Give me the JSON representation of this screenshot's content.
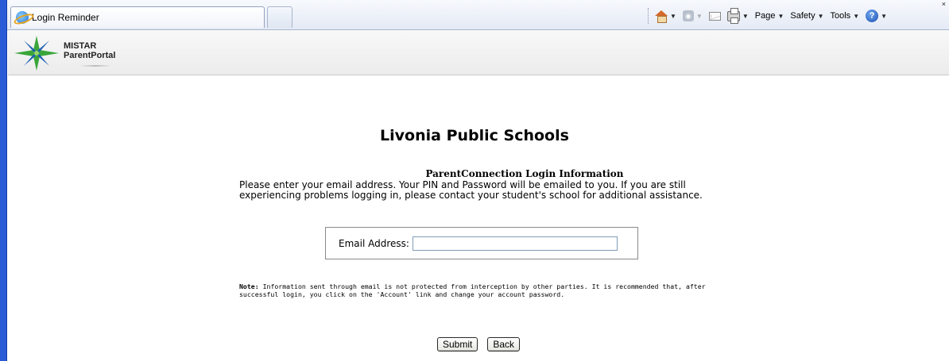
{
  "browser": {
    "tab_title": "Login Reminder",
    "toolbar": {
      "page_label": "Page",
      "safety_label": "Safety",
      "tools_label": "Tools"
    },
    "close_glyph": "×"
  },
  "header": {
    "logo_line1": "MISTAR",
    "logo_line2": "ParentPortal"
  },
  "main": {
    "school_name": "Livonia Public Schools",
    "section_title": "ParentConnection Login Information",
    "instructions": "Please enter your email address. Your PIN and Password will be emailed to you. If you are still experiencing problems logging in, please contact your student's school for additional assistance.",
    "email_label": "Email Address:",
    "email_value": "",
    "note_label": "Note:",
    "note_text": " Information sent through email is not protected from interception by other parties. It is recommended that, after successful login, you click on the 'Account' link and change your account password.",
    "submit_label": "Submit",
    "back_label": "Back"
  },
  "colors": {
    "window_frame": "#2a5bd7",
    "logo_green": "#3aa63a",
    "logo_blue": "#1d5fb3"
  }
}
